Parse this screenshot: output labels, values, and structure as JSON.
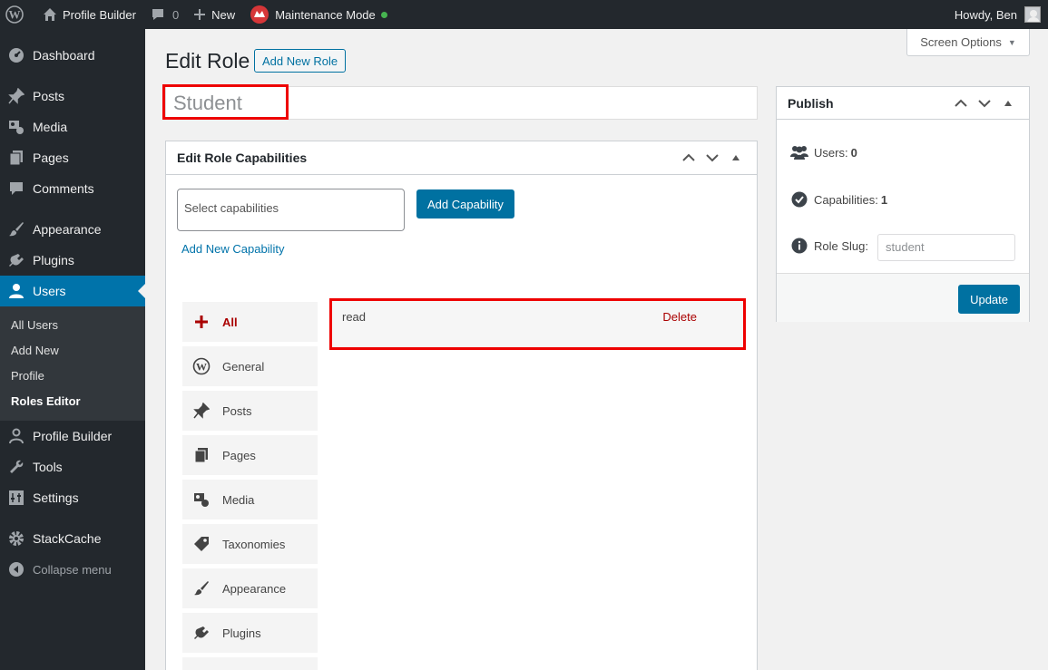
{
  "adminbar": {
    "site_name": "Profile Builder",
    "comments_count": "0",
    "new_label": "New",
    "maintenance_label": "Maintenance Mode",
    "greeting": "Howdy, Ben"
  },
  "sidebar": {
    "items": [
      {
        "label": "Dashboard",
        "icon": "dashboard-icon"
      },
      {
        "label": "Posts",
        "icon": "pin-icon"
      },
      {
        "label": "Media",
        "icon": "media-icon"
      },
      {
        "label": "Pages",
        "icon": "pages-icon"
      },
      {
        "label": "Comments",
        "icon": "comment-icon"
      },
      {
        "label": "Appearance",
        "icon": "brush-icon"
      },
      {
        "label": "Plugins",
        "icon": "plug-icon"
      },
      {
        "label": "Users",
        "icon": "user-icon"
      },
      {
        "label": "Profile Builder",
        "icon": "person-outline-icon"
      },
      {
        "label": "Tools",
        "icon": "wrench-icon"
      },
      {
        "label": "Settings",
        "icon": "settings-icon"
      },
      {
        "label": "StackCache",
        "icon": "gear-icon"
      },
      {
        "label": "Collapse menu",
        "icon": "collapse-icon"
      }
    ],
    "users_submenu": [
      "All Users",
      "Add New",
      "Profile",
      "Roles Editor"
    ]
  },
  "main": {
    "screen_options": "Screen Options",
    "title": "Edit Role",
    "add_new_role": "Add New Role",
    "role_name": "Student",
    "capabilities_box": {
      "title": "Edit Role Capabilities",
      "select_placeholder": "Select capabilities",
      "add_button": "Add Capability",
      "add_new_link": "Add New Capability",
      "groups": [
        "All",
        "General",
        "Posts",
        "Pages",
        "Media",
        "Taxonomies",
        "Appearance",
        "Plugins"
      ],
      "capabilities": [
        {
          "name": "read",
          "action": "Delete"
        }
      ]
    },
    "publish_box": {
      "title": "Publish",
      "users_label": "Users:",
      "users_count": "0",
      "capabilities_label": "Capabilities:",
      "capabilities_count": "1",
      "slug_label": "Role Slug:",
      "slug_value": "student",
      "update_button": "Update"
    }
  },
  "colors": {
    "admin_dark": "#23282d",
    "accent": "#0073aa",
    "highlight": "#ee0000",
    "delete": "#aa0000"
  }
}
